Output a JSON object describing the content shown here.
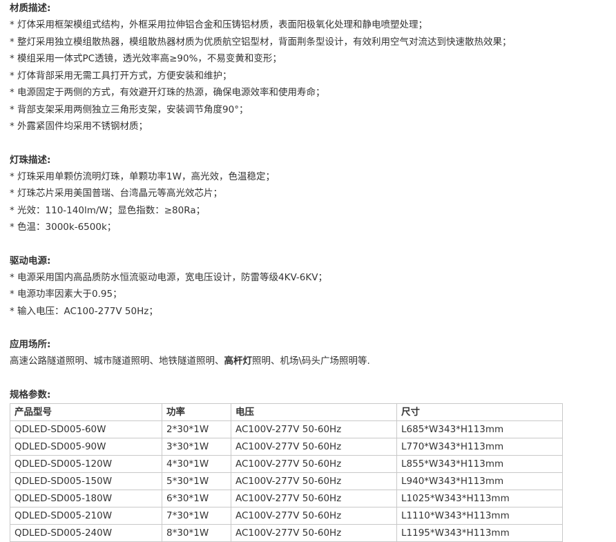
{
  "materials": {
    "heading": "材质描述:",
    "items": [
      "* 灯体采用框架模组式结构，外框采用拉伸铝合金和压铸铝材质，表面阳极氧化处理和静电喷塑处理；",
      "* 整灯采用独立模组散热器，模组散热器材质为优质航空铝型材，背面荆条型设计，有效利用空气对流达到快速散热效果；",
      "* 模组采用一体式PC透镜，透光效率高≥90%，不易变黄和变形；",
      "* 灯体背部采用无需工具打开方式，方便安装和维护；",
      "* 电源固定于两侧的方式，有效避开灯珠的热源，确保电源效率和使用寿命；",
      "* 背部支架采用两侧独立三角形支架，安装调节角度90°；",
      "* 外露紧固件均采用不锈钢材质；"
    ]
  },
  "leds": {
    "heading": "灯珠描述:",
    "items": [
      "* 灯珠采用单颗仿流明灯珠，单颗功率1W，高光效，色温稳定；",
      "* 灯珠芯片采用美国普瑞、台湾晶元等高光效芯片；",
      "* 光效：110-140lm/W；显色指数：≥80Ra；",
      "* 色温：3000k-6500k；"
    ]
  },
  "power": {
    "heading": "驱动电源:",
    "items": [
      "* 电源采用国内高品质防水恒流驱动电源，宽电压设计，防雷等级4KV-6KV；",
      "* 电源功率因素大于0.95；",
      "* 输入电压：AC100-277V 50Hz；"
    ]
  },
  "applications": {
    "heading": "应用场所:",
    "text_before": "高速公路隧道照明、城市隧道照明、地铁隧道照明、",
    "text_bold": "高杆灯",
    "text_after": "照明、机场\\码头广场照明等."
  },
  "specs": {
    "heading": "规格参数:",
    "columns": [
      "产品型号",
      "功率",
      "电压",
      "尺寸"
    ],
    "rows": [
      [
        "QDLED-SD005-60W",
        "2*30*1W",
        "AC100V-277V 50-60Hz",
        "L685*W343*H113mm"
      ],
      [
        "QDLED-SD005-90W",
        "3*30*1W",
        "AC100V-277V 50-60Hz",
        "L770*W343*H113mm"
      ],
      [
        "QDLED-SD005-120W",
        "4*30*1W",
        "AC100V-277V 50-60Hz",
        "L855*W343*H113mm"
      ],
      [
        "QDLED-SD005-150W",
        "5*30*1W",
        "AC100V-277V 50-60Hz",
        "L940*W343*H113mm"
      ],
      [
        "QDLED-SD005-180W",
        "6*30*1W",
        "AC100V-277V 50-60Hz",
        "L1025*W343*H113mm"
      ],
      [
        "QDLED-SD005-210W",
        "7*30*1W",
        "AC100V-277V 50-60Hz",
        "L1110*W343*H113mm"
      ],
      [
        "QDLED-SD005-240W",
        "8*30*1W",
        "AC100V-277V 50-60Hz",
        "L1195*W343*H113mm"
      ]
    ]
  }
}
